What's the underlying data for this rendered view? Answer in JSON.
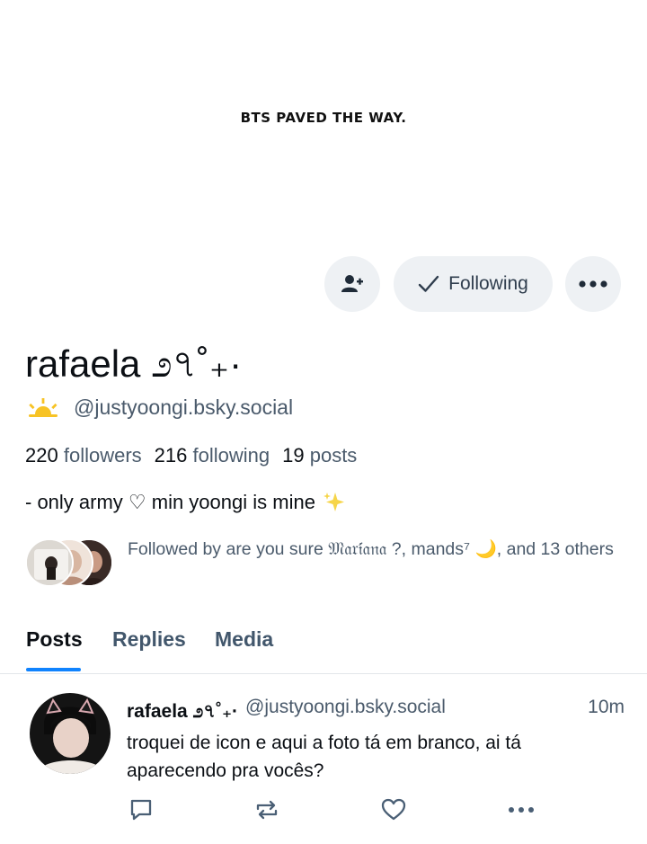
{
  "banner": {
    "text": "BTS PAVED THE WAY."
  },
  "actions": {
    "following_label": "Following"
  },
  "profile": {
    "display_name": "rafaela ೨৭˚₊·",
    "handle": "@justyoongi.bsky.social",
    "followers_count": "220",
    "followers_label": "followers",
    "following_count": "216",
    "following_label": "following",
    "posts_count": "19",
    "posts_label": "posts",
    "bio": "- only army ♡ min yoongi is mine",
    "followed_by": "Followed by are you sure 𝔐𝔞𝔯𝔦́𝔞𝔫𝔞 ?, mands⁷ 🌙, and 13 others"
  },
  "tabs": [
    "Posts",
    "Replies",
    "Media"
  ],
  "post": {
    "author": "rafaela ೨৭˚₊·",
    "handle": "@justyoongi.bsky.social",
    "time": "10m",
    "text": "troquei de icon e aqui a foto tá em branco, ai tá aparecendo pra vocês?"
  },
  "colors": {
    "accent": "#1083fe",
    "button_bg": "#eef1f4",
    "muted_text": "#4a5a6b"
  }
}
